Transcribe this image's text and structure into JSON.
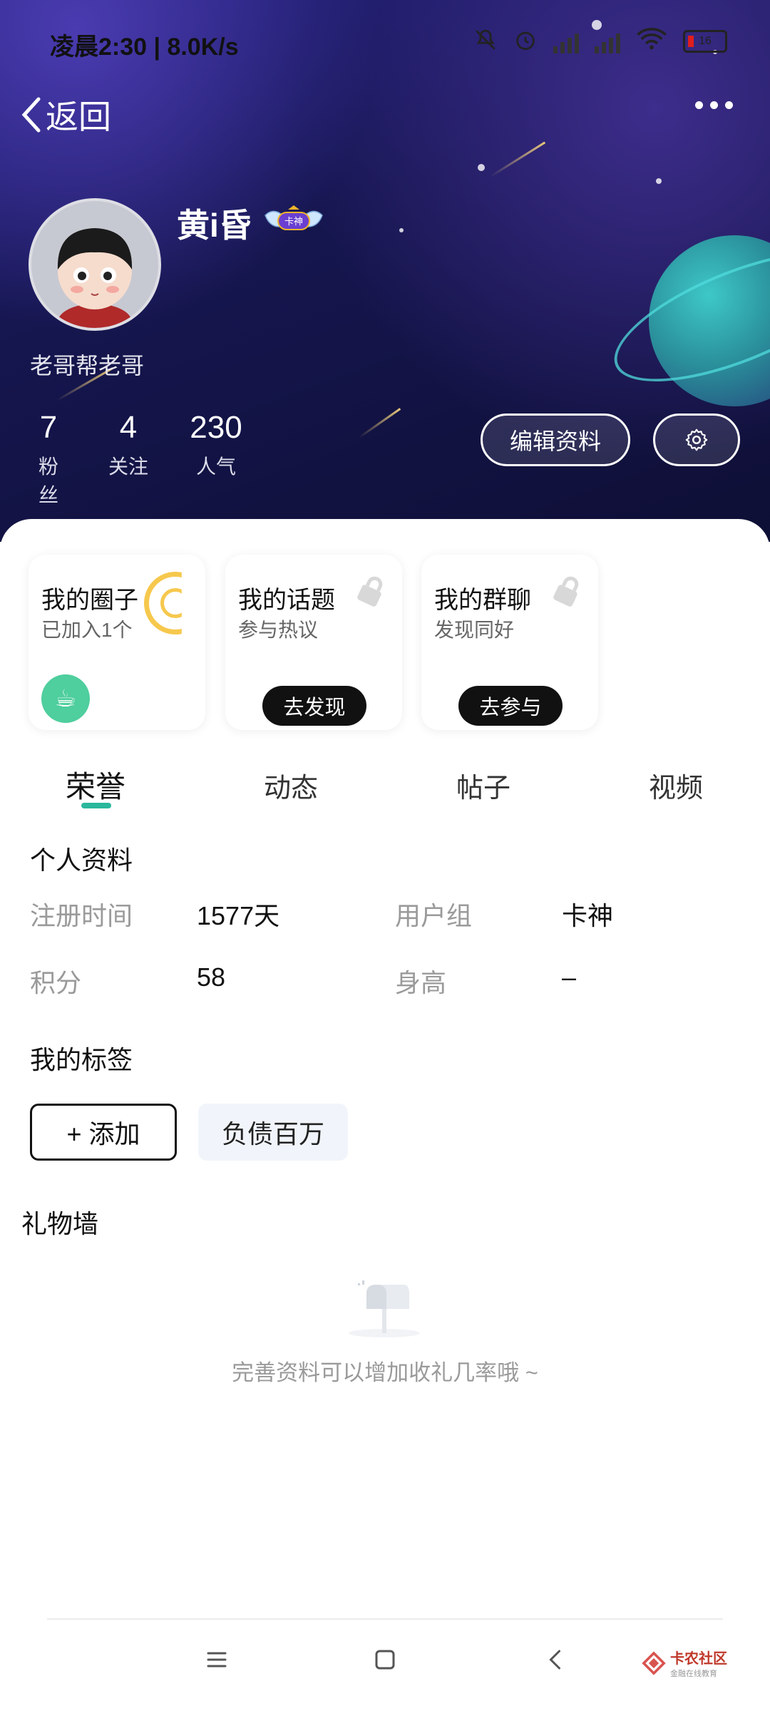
{
  "status_bar": {
    "time_speed": "凌晨2:30 | 8.0K/s",
    "battery": "16"
  },
  "nav": {
    "back_label": "返回"
  },
  "profile": {
    "username": "黄i昏",
    "badge_label": "卡神",
    "signature": "老哥帮老哥",
    "stats": [
      {
        "value": "7",
        "label": "粉丝"
      },
      {
        "value": "4",
        "label": "关注"
      },
      {
        "value": "230",
        "label": "人气"
      }
    ],
    "edit_button": "编辑资料"
  },
  "cards": [
    {
      "title": "我的圈子",
      "subtitle": "已加入1个"
    },
    {
      "title": "我的话题",
      "subtitle": "参与热议",
      "button": "去发现"
    },
    {
      "title": "我的群聊",
      "subtitle": "发现同好",
      "button": "去参与"
    }
  ],
  "tabs": [
    "荣誉",
    "动态",
    "帖子",
    "视频"
  ],
  "personal_info": {
    "title": "个人资料",
    "fields": [
      {
        "label": "注册时间",
        "value": "1577天"
      },
      {
        "label": "用户组",
        "value": "卡神"
      },
      {
        "label": "积分",
        "value": "58"
      },
      {
        "label": "身高",
        "value": "–"
      }
    ]
  },
  "tags_section": {
    "title": "我的标签",
    "add_label": "+ 添加",
    "tags": [
      "负债百万"
    ]
  },
  "gift_wall": {
    "title": "礼物墙",
    "empty_text": "完善资料可以增加收礼几率哦 ~"
  },
  "watermark": {
    "name": "卡农社区",
    "sub": "金融在线教育"
  },
  "colors": {
    "accent": "#2ab79c",
    "header_dark": "#161650",
    "button_dark": "#111111"
  }
}
